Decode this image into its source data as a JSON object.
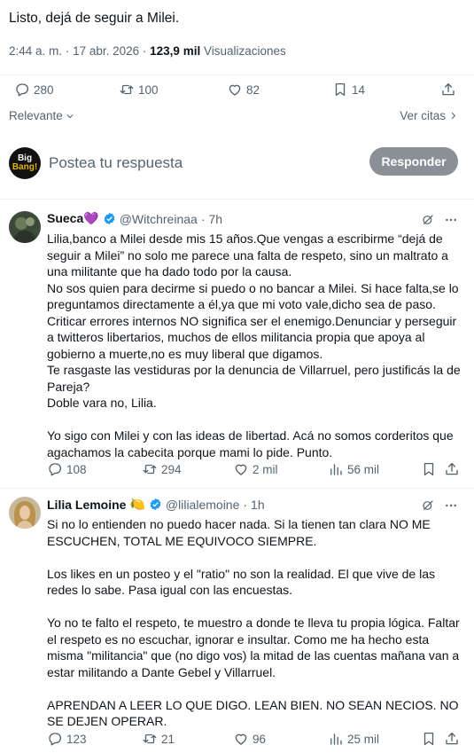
{
  "main_tweet": {
    "text": "Listo, dejá de seguir a Milei.",
    "time": "2:44 a. m.",
    "date": "17 abr. 2026",
    "views_count": "123,9 mil",
    "views_label": "Visualizaciones",
    "actions": {
      "replies": "280",
      "reposts": "100",
      "likes": "82",
      "bookmarks": "14"
    }
  },
  "sort": {
    "relevant_label": "Relevante",
    "see_quotes_label": "Ver citas"
  },
  "compose": {
    "avatar_text_1": "Big",
    "avatar_text_2": "Bang!",
    "placeholder": "Postea tu respuesta",
    "reply_button": "Responder"
  },
  "replies": [
    {
      "name": "Sueca💜",
      "handle": "@Witchreinaa",
      "time": "7h",
      "paragraphs": [
        "Lilia,banco a Milei desde mis 15 años.Que vengas a escribirme “dejá de seguir a Milei” no solo me parece una falta de respeto, sino un maltrato a una militante que ha dado todo por la causa.",
        "No sos quien para decirme si puedo o no bancar a Milei. Si hace falta,se lo preguntamos directamente a él,ya que mi voto vale,dicho sea de paso.",
        "Criticar errores internos NO significa ser el enemigo.Denunciar y perseguir a twitteros libertarios, muchos de ellos militancia propia que apoya al gobierno a muerte,no es muy liberal que digamos.",
        "Te rasgaste las vestiduras por la denuncia de Villarruel, pero justificás la de Pareja?",
        "Doble vara no, Lilia.",
        "",
        "Yo sigo con Milei y con las ideas de libertad. Acá no somos corderitos que agachamos la cabecita porque mami lo pide. Punto."
      ],
      "actions": {
        "replies": "108",
        "reposts": "294",
        "likes": "2 mil",
        "views": "56 mil"
      }
    },
    {
      "name": "Lilia Lemoine",
      "name_emoji": "🍋",
      "handle": "@lilialemoine",
      "time": "1h",
      "paragraphs": [
        "Si no lo entienden no puedo hacer nada. Si la tienen tan clara  NO ME ESCUCHEN, TOTAL ME EQUIVOCO SIEMPRE.",
        "",
        "Los likes en un posteo y el \"ratio\" no son la realidad. El que vive de las redes lo sabe. Pasa igual con las encuestas.",
        "",
        "Yo no te falto el respeto, te muestro a donde te lleva tu propia lógica. Faltar el respeto es no escuchar, ignorar e insultar. Como me ha hecho esta misma \"militancia\" que (no digo vos) la mitad de las cuentas mañana van a estar militando a Dante Gebel y Villarruel.",
        "",
        "APRENDAN A LEER LO QUE DIGO. LEAN BIEN. NO SEAN NECIOS. NO SE DEJEN OPERAR."
      ],
      "actions": {
        "replies": "123",
        "reposts": "21",
        "likes": "96",
        "views": "25 mil"
      }
    }
  ]
}
